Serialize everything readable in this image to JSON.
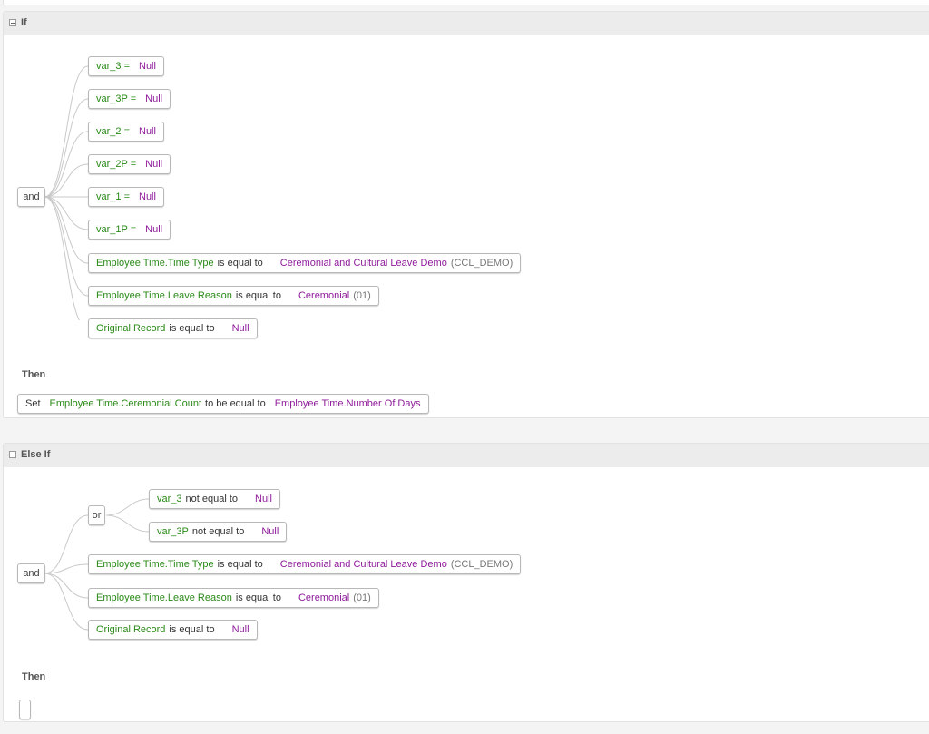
{
  "if_block": {
    "title": "If",
    "root_operator": "and",
    "conditions": [
      {
        "field": "var_3 =",
        "value": "Null"
      },
      {
        "field": "var_3P =",
        "value": "Null"
      },
      {
        "field": "var_2 =",
        "value": "Null"
      },
      {
        "field": "var_2P =",
        "value": "Null"
      },
      {
        "field": "var_1 =",
        "value": "Null"
      },
      {
        "field": "var_1P =",
        "value": "Null"
      },
      {
        "field": "Employee Time.Time Type",
        "operator": "is equal to",
        "value": "Ceremonial and Cultural Leave Demo",
        "code": "(CCL_DEMO)"
      },
      {
        "field": "Employee Time.Leave Reason",
        "operator": "is equal to",
        "value": "Ceremonial",
        "code": "(01)"
      },
      {
        "field": "Original Record",
        "operator": "is equal to",
        "value": "Null"
      }
    ],
    "then_label": "Then",
    "action": {
      "verb": "Set",
      "field": "Employee Time.Ceremonial Count",
      "operator": "to be equal to",
      "value": "Employee Time.Number Of Days"
    }
  },
  "else_if_block": {
    "title": "Else If",
    "root_operator": "and",
    "sub_operator": "or",
    "sub_conditions": [
      {
        "field": "var_3",
        "operator": "not equal to",
        "value": "Null"
      },
      {
        "field": "var_3P",
        "operator": "not equal to",
        "value": "Null"
      }
    ],
    "conditions": [
      {
        "field": "Employee Time.Time Type",
        "operator": "is equal to",
        "value": "Ceremonial and Cultural Leave Demo",
        "code": "(CCL_DEMO)"
      },
      {
        "field": "Employee Time.Leave Reason",
        "operator": "is equal to",
        "value": "Ceremonial",
        "code": "(01)"
      },
      {
        "field": "Original Record",
        "operator": "is equal to",
        "value": "Null"
      }
    ],
    "then_label": "Then"
  }
}
